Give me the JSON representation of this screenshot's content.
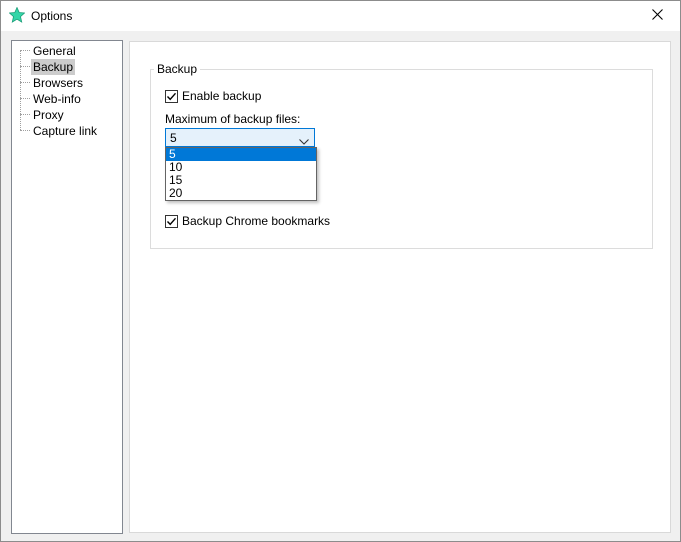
{
  "window": {
    "title": "Options",
    "icon": "green-star-icon"
  },
  "tree": {
    "items": [
      {
        "label": "General",
        "selected": false
      },
      {
        "label": "Backup",
        "selected": true
      },
      {
        "label": "Browsers",
        "selected": false
      },
      {
        "label": "Web-info",
        "selected": false
      },
      {
        "label": "Proxy",
        "selected": false
      },
      {
        "label": "Capture link",
        "selected": false
      }
    ]
  },
  "backup": {
    "group_title": "Backup",
    "enable_backup": {
      "label": "Enable backup",
      "checked": true
    },
    "max_files_label": "Maximum of backup files:",
    "max_files_value": "5",
    "max_files_options": [
      "5",
      "10",
      "15",
      "20"
    ],
    "chrome_bookmarks": {
      "label": "Backup Chrome bookmarks",
      "checked": true
    }
  },
  "colors": {
    "accent": "#0078d7",
    "selection": "#cccccc"
  }
}
